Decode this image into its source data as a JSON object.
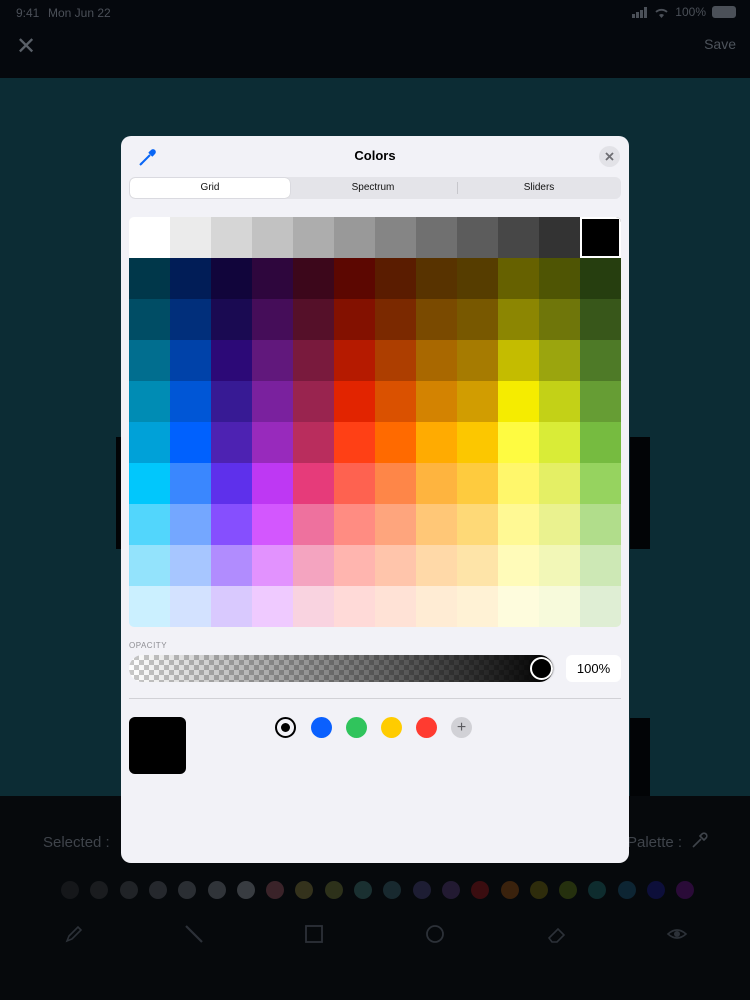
{
  "status_bar": {
    "time": "9:41",
    "date": "Mon Jun 22",
    "battery": "100%"
  },
  "toolbar": {
    "close_icon": "close-icon",
    "save_label": "Save"
  },
  "bottom_panel": {
    "selected_label": "Selected :",
    "palette_label": "Palette :",
    "swatches": [
      "#15171a",
      "#1a1c1f",
      "#202327",
      "#25282d",
      "#2a2e33",
      "#303439",
      "#383c41",
      "#3a2329",
      "#34321c",
      "#2d311a",
      "#1a3031",
      "#18292f",
      "#1d1d33",
      "#221a32",
      "#3a0d10",
      "#3a220d",
      "#2e2c0c",
      "#25300e",
      "#0e2c2e",
      "#0d2533",
      "#0d0f3a",
      "#2a0b38"
    ]
  },
  "modal": {
    "title": "Colors",
    "tabs": [
      {
        "label": "Grid",
        "active": true
      },
      {
        "label": "Spectrum",
        "active": false
      },
      {
        "label": "Sliders",
        "active": false
      }
    ],
    "grid_rows": [
      [
        "#ffffff",
        "#ebebeb",
        "#d6d6d6",
        "#c2c2c2",
        "#adadad",
        "#999999",
        "#858585",
        "#707070",
        "#5c5c5c",
        "#474747",
        "#333333",
        "#000000"
      ],
      [
        "#00374a",
        "#011d57",
        "#11053b",
        "#2e063d",
        "#3c071b",
        "#5c0701",
        "#5a1c00",
        "#583300",
        "#563d00",
        "#666100",
        "#4f5504",
        "#263e0f"
      ],
      [
        "#004d65",
        "#012f7b",
        "#1a0a52",
        "#450d59",
        "#551029",
        "#831100",
        "#7b2900",
        "#7a4a00",
        "#785800",
        "#8c8602",
        "#6f760a",
        "#38571a"
      ],
      [
        "#016e8f",
        "#0042a9",
        "#2c0977",
        "#61187c",
        "#791a3d",
        "#b51a00",
        "#ad3e00",
        "#a96800",
        "#a67b01",
        "#c4bc00",
        "#9ba50e",
        "#4e7a27"
      ],
      [
        "#008cb4",
        "#0056d6",
        "#371a94",
        "#7a219e",
        "#99244f",
        "#e22400",
        "#da5100",
        "#d38301",
        "#d19d01",
        "#f5ec00",
        "#c3d117",
        "#669d34"
      ],
      [
        "#00a1d8",
        "#0061fe",
        "#4d22b2",
        "#982abc",
        "#b92d5d",
        "#ff4015",
        "#ff6a00",
        "#ffab01",
        "#fcc700",
        "#fefb41",
        "#d9ec37",
        "#76bb40"
      ],
      [
        "#01c7fc",
        "#3a87fe",
        "#5e30eb",
        "#be38f3",
        "#e63b7a",
        "#fe6250",
        "#fe8648",
        "#feb43f",
        "#fecb3e",
        "#fff76b",
        "#e4ef65",
        "#96d35f"
      ],
      [
        "#52d6fc",
        "#74a7ff",
        "#864ffe",
        "#d357fe",
        "#ee719e",
        "#ff8c82",
        "#fea57d",
        "#ffc777",
        "#fed977",
        "#fff994",
        "#eaf28f",
        "#b1dd8b"
      ],
      [
        "#93e3fc",
        "#a7c6ff",
        "#b18cfe",
        "#e292fe",
        "#f4a4c0",
        "#ffb5af",
        "#ffc5ab",
        "#ffd9a8",
        "#fee4a8",
        "#fffbb9",
        "#f2f7b7",
        "#cde8b5"
      ],
      [
        "#cbf0ff",
        "#d3e2ff",
        "#d9c9fe",
        "#efcaff",
        "#f9d3e0",
        "#ffdad8",
        "#ffe2d6",
        "#ffecd4",
        "#fff2d5",
        "#fefcdd",
        "#f7fadb",
        "#dfeed4"
      ]
    ],
    "opacity_label": "OPACITY",
    "opacity_value": "100%",
    "current_color": "#000000",
    "favorites": [
      "#000000",
      "#0a60fe",
      "#30c45c",
      "#ffcc00",
      "#ff3b30"
    ],
    "add_label": "+"
  }
}
